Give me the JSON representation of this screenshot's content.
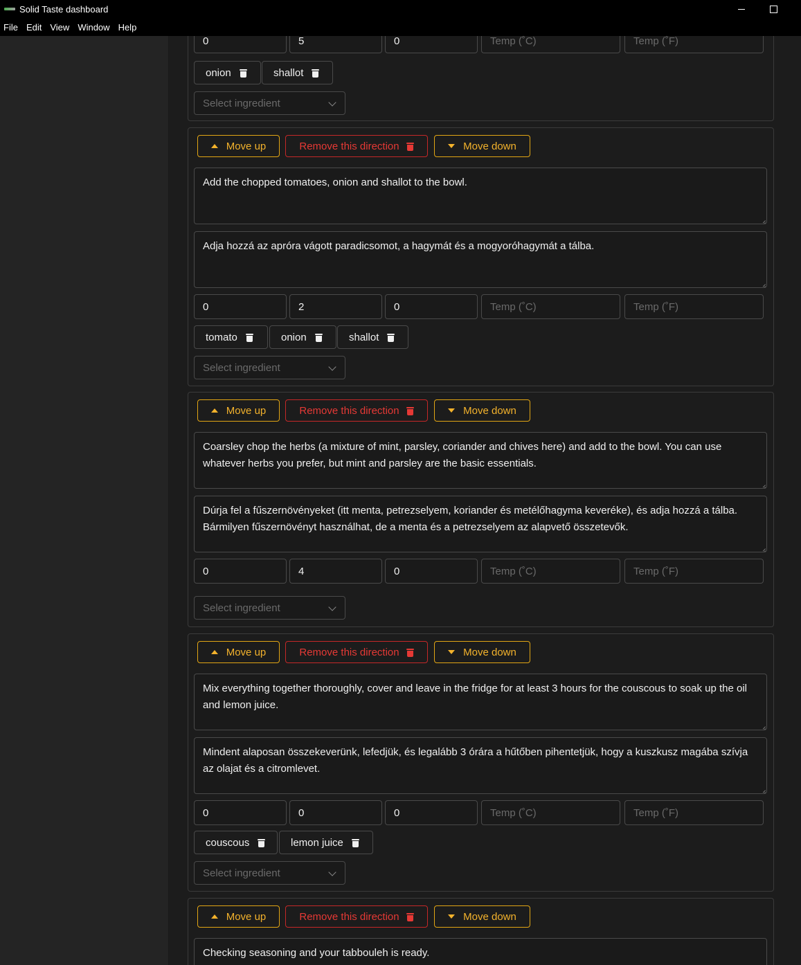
{
  "window": {
    "title": "Solid Taste dashboard"
  },
  "menu": [
    "File",
    "Edit",
    "View",
    "Window",
    "Help"
  ],
  "labels": {
    "move_up": "Move up",
    "remove": "Remove this direction",
    "move_down": "Move down",
    "temp_c_placeholder": "Temp (˚C)",
    "temp_f_placeholder": "Temp (˚F)",
    "select_ingredient": "Select ingredient"
  },
  "top_partial": {
    "values": [
      "0",
      "5",
      "0"
    ],
    "ingredients": [
      "onion",
      "shallot"
    ]
  },
  "directions": [
    {
      "en": "Add the chopped tomatoes, onion and shallot to the bowl.",
      "hu": "Adja hozzá az apróra vágott paradicsomot, a hagymát és a mogyoróhagymát a tálba.",
      "values": [
        "0",
        "2",
        "0"
      ],
      "ingredients": [
        "tomato",
        "onion",
        "shallot"
      ]
    },
    {
      "en": "Coarsley chop the herbs (a mixture of mint, parsley, coriander and chives here) and add to the bowl. You can use whatever herbs you prefer, but mint and parsley are the basic essentials.",
      "hu": "Dúrja fel a fűszernövényeket (itt menta, petrezselyem, koriander és metélőhagyma keveréke), és adja hozzá a tálba. Bármilyen fűszernövényt használhat, de a menta és a petrezselyem az alapvető összetevők.",
      "values": [
        "0",
        "4",
        "0"
      ],
      "ingredients": []
    },
    {
      "en": "Mix everything together thoroughly, cover and leave in the fridge for at least 3 hours for the couscous to soak up the oil and lemon juice.",
      "hu": "Mindent alaposan összekeverünk, lefedjük, és legalább 3 órára a hűtőben pihentetjük, hogy a kuszkusz magába szívja az olajat és a citromlevet.",
      "values": [
        "0",
        "0",
        "0"
      ],
      "ingredients": [
        "couscous",
        "lemon juice"
      ]
    },
    {
      "en": "Checking seasoning and your tabbouleh is ready."
    }
  ]
}
